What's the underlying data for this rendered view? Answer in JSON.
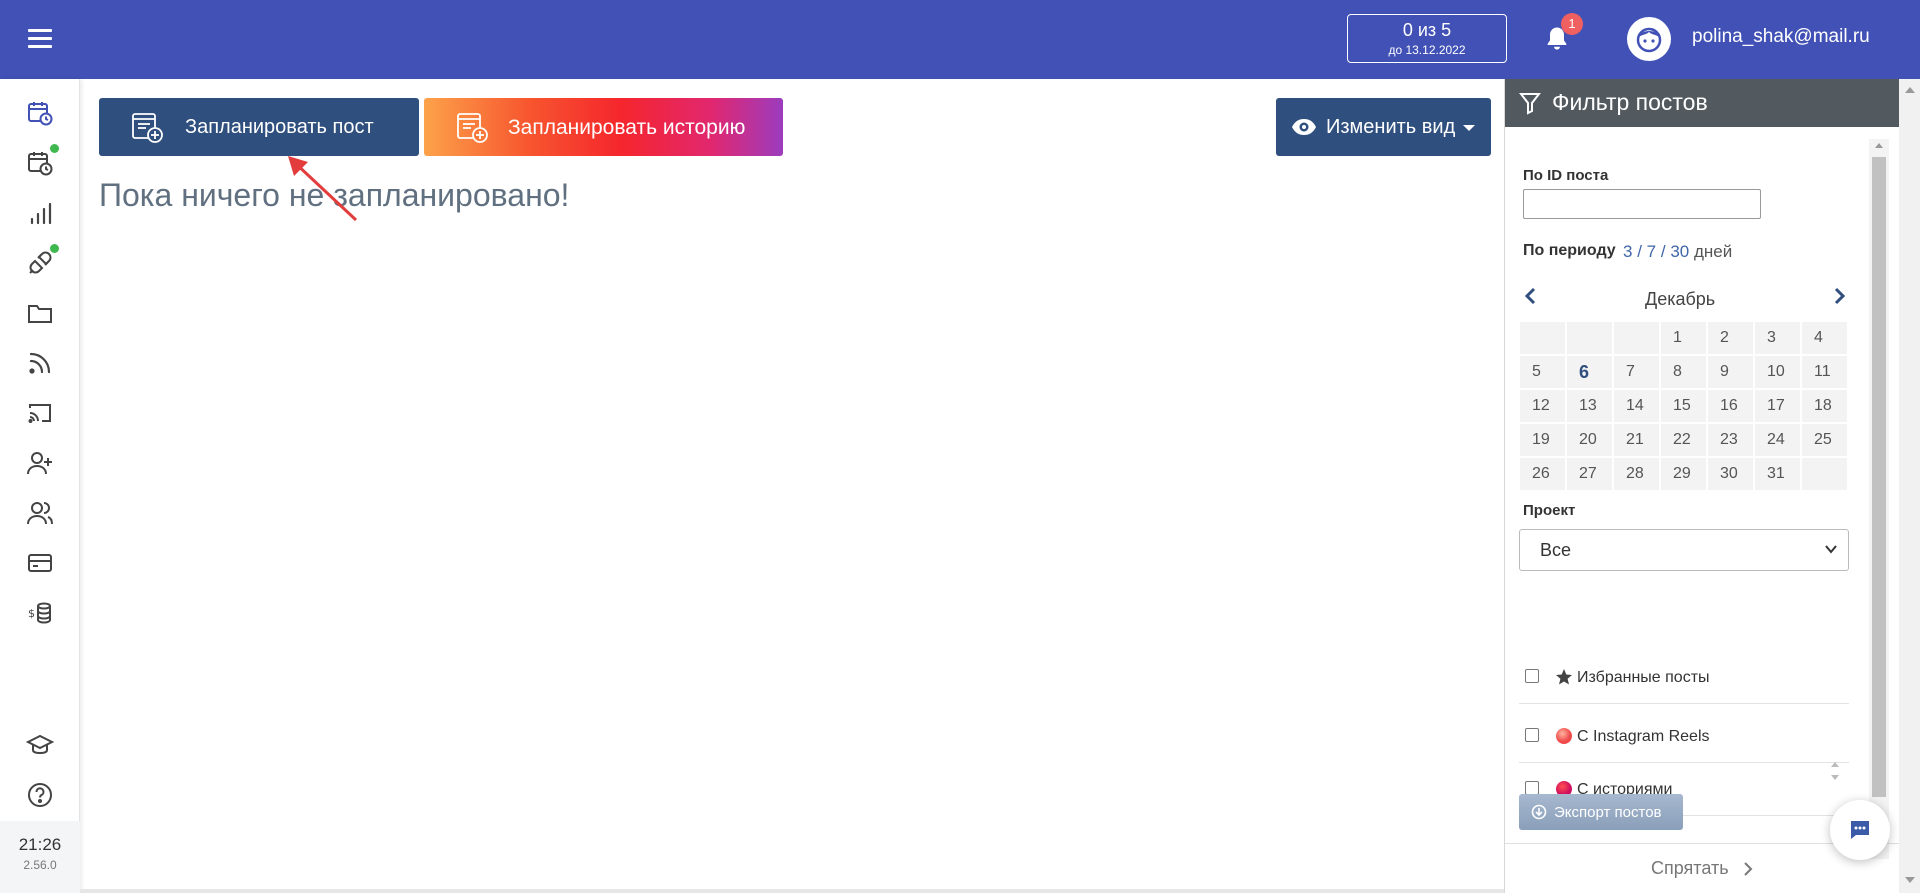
{
  "header": {
    "quota_main": "0 из 5",
    "quota_sub": "до 13.12.2022",
    "notification_count": "1",
    "user_email": "polina_shak@mail.ru",
    "bg_color": "#4151b5"
  },
  "leftnav": {
    "icons": [
      "calendar-clock-icon",
      "calendar-clock-alert-icon",
      "bar-chart-icon",
      "plug-icon",
      "folder-icon",
      "rss-icon",
      "cast-icon",
      "user-plus-icon",
      "users-icon",
      "credit-card-icon",
      "coins-dollar-icon",
      "graduation-cap-icon",
      "help-icon"
    ],
    "clock": "21:26",
    "version": "2.56.0"
  },
  "main": {
    "schedule_post_label": "Запланировать пост",
    "schedule_story_label": "Запланировать историю",
    "change_view_label": "Изменить вид",
    "empty_message": "Пока ничего не запланировано!"
  },
  "filter": {
    "title": "Фильтр постов",
    "by_id_label": "По ID поста",
    "by_id_value": "",
    "by_period_label": "По периоду",
    "period_options": [
      "3",
      "7",
      "30"
    ],
    "period_sep": "/",
    "days_label": "дней",
    "calendar": {
      "month": "Декабрь",
      "today": "6",
      "weeks": [
        [
          "",
          "",
          "",
          "1",
          "2",
          "3",
          "4"
        ],
        [
          "5",
          "6",
          "7",
          "8",
          "9",
          "10",
          "11"
        ],
        [
          "12",
          "13",
          "14",
          "15",
          "16",
          "17",
          "18"
        ],
        [
          "19",
          "20",
          "21",
          "22",
          "23",
          "24",
          "25"
        ],
        [
          "26",
          "27",
          "28",
          "29",
          "30",
          "31",
          ""
        ]
      ]
    },
    "project_label": "Проект",
    "project_value": "Все",
    "checkboxes": [
      {
        "label": "Избранные посты",
        "icon": "star-icon"
      },
      {
        "label": "С Instagram Reels",
        "icon": "reels-icon"
      },
      {
        "label": "С историями",
        "icon": "stories-icon"
      }
    ],
    "export_label": "Экспорт постов",
    "hide_label": "Спрятать"
  },
  "colors": {
    "primary_button": "#2f4f7f",
    "panel_header": "#52595f",
    "online_dot": "#3fb94f",
    "badge": "#f06060"
  }
}
